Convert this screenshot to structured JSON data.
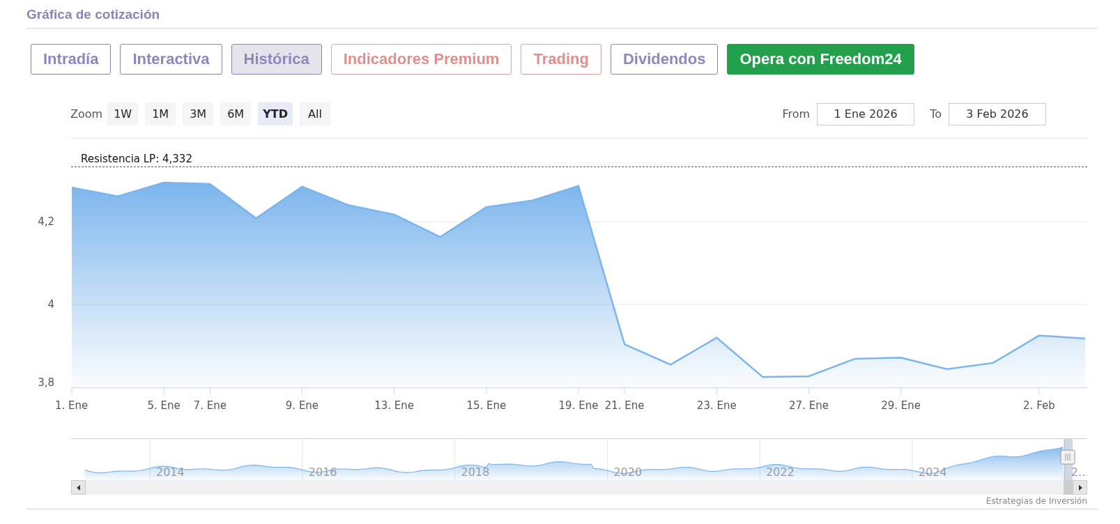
{
  "section": {
    "title": "Gráfica de cotización"
  },
  "tabs": [
    {
      "label": "Intradía",
      "kind": "tab",
      "selected": false
    },
    {
      "label": "Interactiva",
      "kind": "tab",
      "selected": false
    },
    {
      "label": "Histórica",
      "kind": "tab",
      "selected": true
    },
    {
      "label": "Indicadores Premium",
      "kind": "premium",
      "selected": false
    },
    {
      "label": "Trading",
      "kind": "premium",
      "selected": false
    },
    {
      "label": "Dividendos",
      "kind": "tab",
      "selected": false
    },
    {
      "label": "Opera con Freedom24",
      "kind": "cta",
      "selected": false
    }
  ],
  "range_selector": {
    "label": "Zoom",
    "buttons": [
      {
        "label": "1W",
        "selected": false
      },
      {
        "label": "1M",
        "selected": false
      },
      {
        "label": "3M",
        "selected": false
      },
      {
        "label": "6M",
        "selected": false
      },
      {
        "label": "YTD",
        "selected": true
      },
      {
        "label": "All",
        "selected": false
      }
    ],
    "from_label": "From",
    "from_value": "1 Ene 2026",
    "to_label": "To",
    "to_value": "3 Feb 2026"
  },
  "chart": {
    "chart_data": {
      "type": "area",
      "series": [
        {
          "color": "#7cb5ec",
          "values": [
            4.282,
            4.261,
            4.294,
            4.291,
            4.208,
            4.284,
            4.24,
            4.217,
            4.163,
            4.235,
            4.251,
            4.286,
            3.904,
            3.855,
            3.92,
            3.825,
            3.827,
            3.869,
            3.872,
            3.844,
            3.859,
            3.925,
            3.918
          ]
        }
      ],
      "categories": [
        "1. Ene",
        null,
        "5. Ene",
        "7. Ene",
        null,
        "9. Ene",
        null,
        "13. Ene",
        null,
        "15. Ene",
        null,
        "19. Ene",
        "21. Ene",
        null,
        "23. Ene",
        null,
        "27. Ene",
        null,
        "29. Ene",
        null,
        null,
        "2. Feb",
        null
      ],
      "ylim": [
        3.8,
        4.4
      ],
      "yticks": [
        {
          "value": 3.8,
          "label": "3,8"
        },
        {
          "value": 4,
          "label": "4"
        },
        {
          "value": 4.2,
          "label": "4,2"
        }
      ],
      "ref_lines": [
        {
          "axis": "y",
          "label": "Resistencia LP: 4,332",
          "value": 4.332
        }
      ]
    }
  },
  "navigator": {
    "labels": [
      "2014",
      "2016",
      "2018",
      "2020",
      "2022",
      "2024",
      "2…"
    ]
  },
  "credit": "Estrategias de Inversión"
}
